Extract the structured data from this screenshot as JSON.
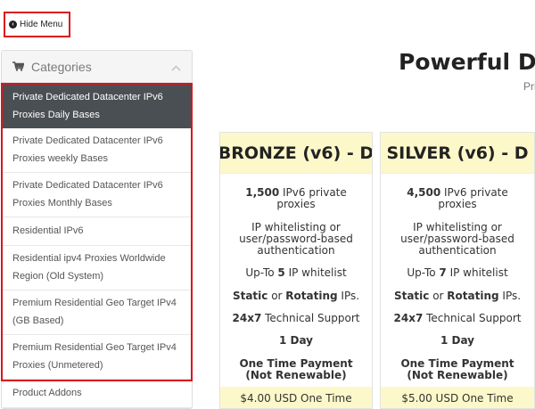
{
  "hide_menu": {
    "label": "Hide Menu",
    "icon": "arrow-circle-left-icon"
  },
  "colors": {
    "highlight_border": "#d9141e",
    "active_item_bg": "#4a4f53",
    "plan_header_bg": "#fdf8c9"
  },
  "sidebar": {
    "title": "Categories",
    "items": [
      {
        "label": "Private Dedicated Datacenter IPv6 Proxies Daily Bases",
        "active": true
      },
      {
        "label": "Private Dedicated Datacenter IPv6 Proxies weekly Bases"
      },
      {
        "label": "Private Dedicated Datacenter IPv6 Proxies Monthly Bases"
      },
      {
        "label": "Residential IPv6"
      },
      {
        "label": "Residential ipv4 Proxies Worldwide Region (Old System)"
      },
      {
        "label": "Premium Residential Geo Target IPv4 (GB Based)"
      },
      {
        "label": "Premium Residential Geo Target IPv4 Proxies (Unmetered)"
      },
      {
        "label": "Product Addons"
      }
    ]
  },
  "main": {
    "title": "Powerful Dat",
    "subtitle": "Pri"
  },
  "plans": [
    {
      "name": "BRONZE (v6) - D",
      "proxies_count": "1,500",
      "proxies_text": " IPv6 private proxies",
      "auth": "IP whitelisting or user/password-based authentication",
      "whitelist_pre": "Up-To ",
      "whitelist_num": "5",
      "whitelist_post": " IP whitelist",
      "static": "Static",
      "or": " or ",
      "rotating": "Rotating",
      "ips": " IPs.",
      "support_bold": "24x7",
      "support_text": " Technical Support",
      "duration": "1 Day",
      "payment": "One Time Payment (Not Renewable)",
      "price": "$4.00 USD One Time"
    },
    {
      "name": "SILVER (v6) - D",
      "proxies_count": "4,500",
      "proxies_text": " IPv6 private proxies",
      "auth": "IP whitelisting or user/password-based authentication",
      "whitelist_pre": "Up-To ",
      "whitelist_num": "7",
      "whitelist_post": " IP whitelist",
      "static": "Static",
      "or": " or ",
      "rotating": "Rotating",
      "ips": " IPs.",
      "support_bold": "24x7",
      "support_text": " Technical Support",
      "duration": "1 Day",
      "payment": "One Time Payment (Not Renewable)",
      "price": "$5.00 USD One Time"
    }
  ]
}
